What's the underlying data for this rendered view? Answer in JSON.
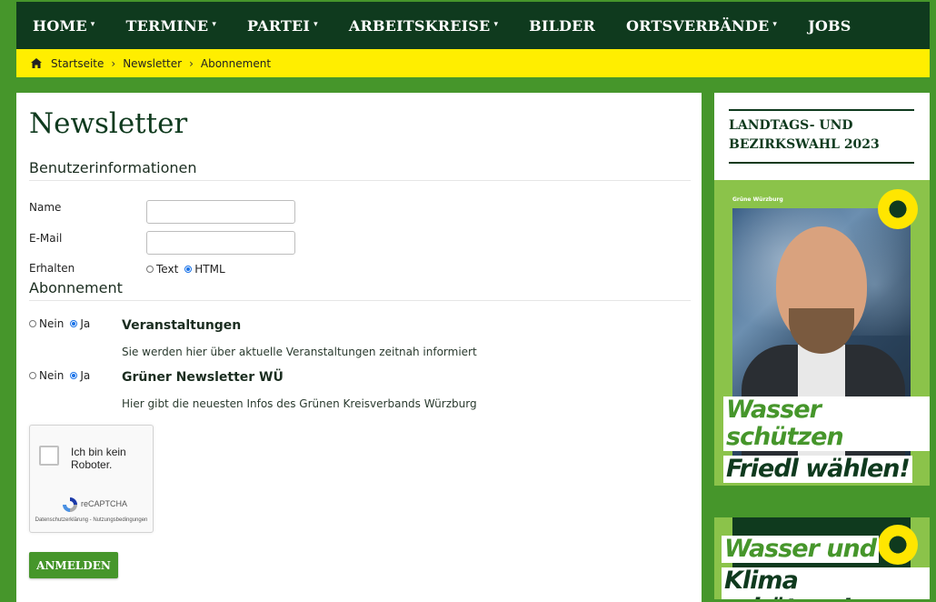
{
  "nav": {
    "items": [
      {
        "label": "HOME",
        "caret": "▾"
      },
      {
        "label": "TERMINE",
        "caret": "▾"
      },
      {
        "label": "PARTEI",
        "caret": "▾"
      },
      {
        "label": "ARBEITSKREISE",
        "caret": "▾"
      },
      {
        "label": "BILDER",
        "caret": ""
      },
      {
        "label": "ORTSVERBÄNDE",
        "caret": "▾"
      },
      {
        "label": "JOBS",
        "caret": ""
      }
    ]
  },
  "breadcrumb": {
    "home_icon": "home-icon",
    "items": [
      "Startseite",
      "Newsletter",
      "Abonnement"
    ],
    "separator": "›"
  },
  "main": {
    "title": "Newsletter",
    "user_section": "Benutzerinformationen",
    "name_label": "Name",
    "name_value": "",
    "email_label": "E-Mail",
    "email_value": "",
    "receive_label": "Erhalten",
    "format_options": [
      {
        "label": "Text",
        "selected": false
      },
      {
        "label": "HTML",
        "selected": true
      }
    ],
    "subscription_section": "Abonnement",
    "subscriptions": [
      {
        "no_label": "Nein",
        "yes_label": "Ja",
        "selected": "yes",
        "title": "Veranstaltungen",
        "description": "Sie werden hier über aktuelle Veranstaltungen zeitnah informiert"
      },
      {
        "no_label": "Nein",
        "yes_label": "Ja",
        "selected": "yes",
        "title": "Grüner Newsletter WÜ",
        "description": "Hier gibt die neuesten Infos des Grünen Kreisverbands Würzburg"
      }
    ],
    "captcha": {
      "text": "Ich bin kein Roboter.",
      "brand": "reCAPTCHA",
      "legal": "Datenschutzerklärung - Nutzungsbedingungen"
    },
    "submit_label": "ANMELDEN"
  },
  "sidebar": {
    "card_title": "LANDTAGS- UND BEZIRKSWAHL 2023",
    "poster": {
      "small_text": "Grüne Würzburg",
      "slogan_line1": "Wasser schützen",
      "slogan_line2": "Friedl wählen!"
    },
    "poster2": {
      "slogan_line1": "Wasser und",
      "slogan_line2": "Klima schützen!"
    }
  },
  "colors": {
    "green": "#46962b",
    "dark_green": "#0f3a1e",
    "yellow": "#ffee00",
    "light_green": "#8bc34a"
  }
}
